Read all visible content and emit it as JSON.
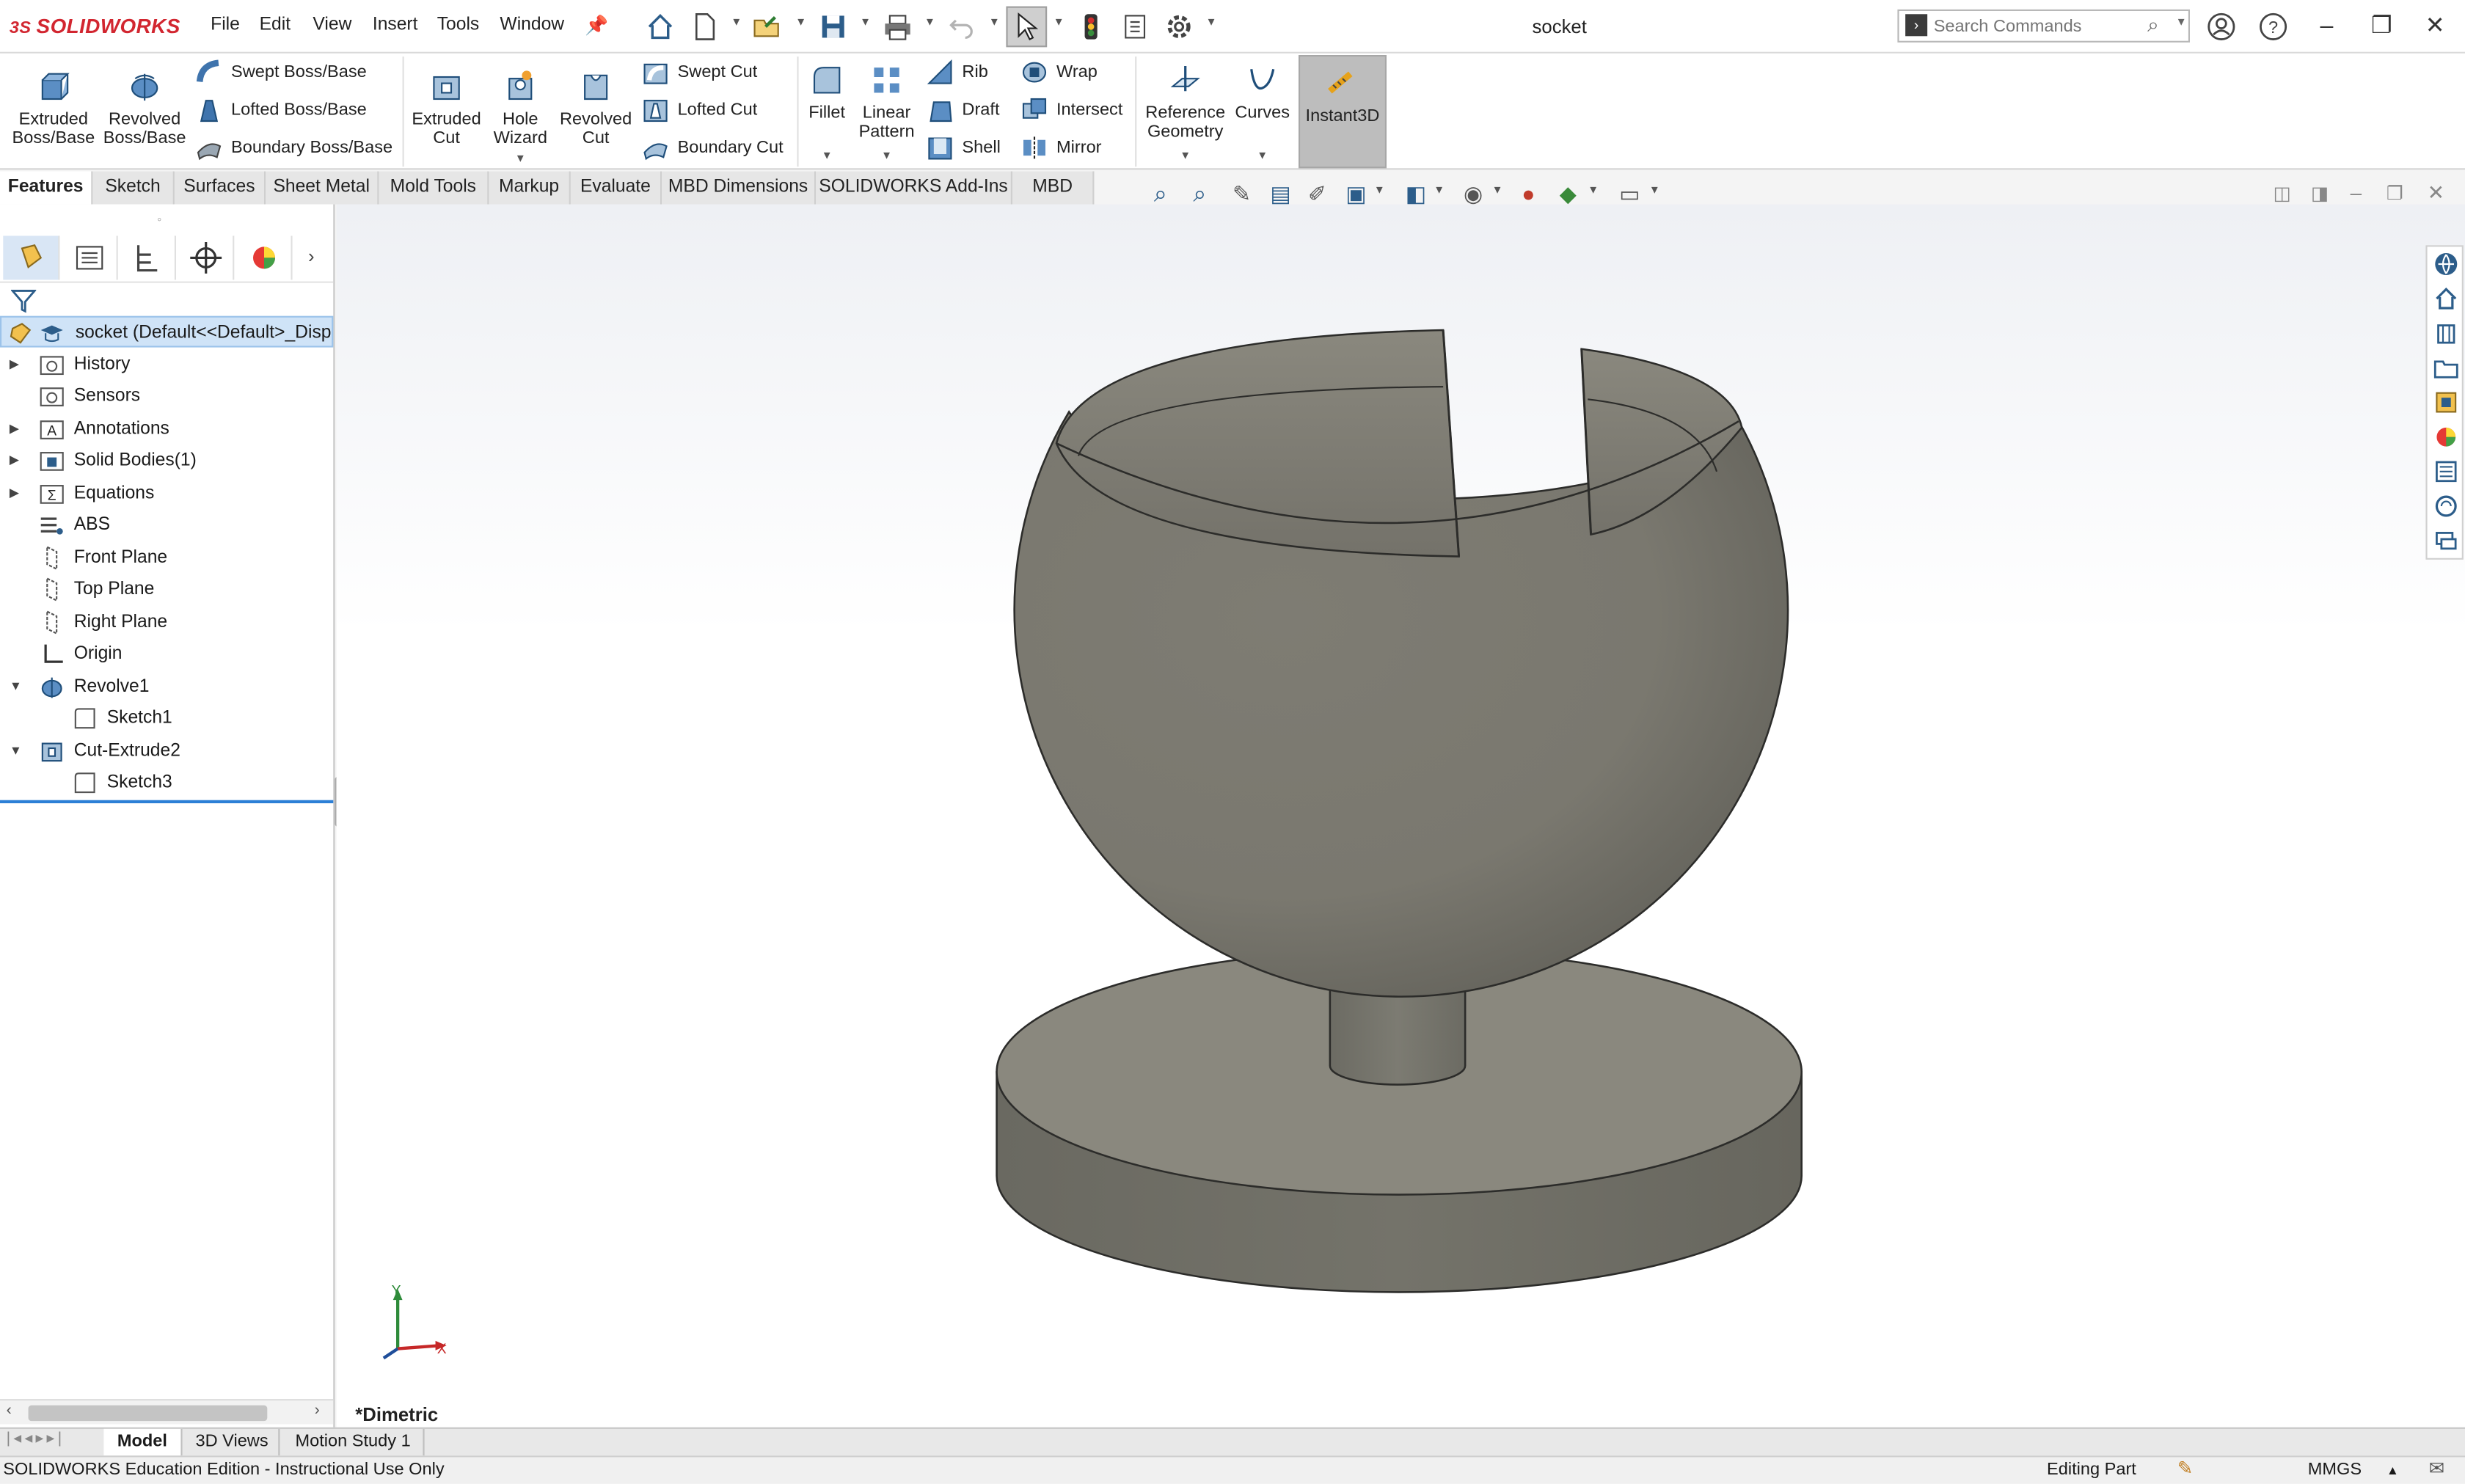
{
  "app": {
    "logo_text": "SOLIDWORKS",
    "document_title": "socket"
  },
  "menu": [
    "File",
    "Edit",
    "View",
    "Insert",
    "Tools",
    "Window"
  ],
  "search": {
    "placeholder": "Search Commands"
  },
  "ribbon": {
    "extruded_boss": [
      "Extruded",
      "Boss/Base"
    ],
    "revolved_boss": [
      "Revolved",
      "Boss/Base"
    ],
    "swept_boss": "Swept Boss/Base",
    "lofted_boss": "Lofted Boss/Base",
    "boundary_boss": "Boundary Boss/Base",
    "extruded_cut": [
      "Extruded",
      "Cut"
    ],
    "hole_wizard": [
      "Hole",
      "Wizard"
    ],
    "revolved_cut": [
      "Revolved",
      "Cut"
    ],
    "swept_cut": "Swept Cut",
    "lofted_cut": "Lofted Cut",
    "boundary_cut": "Boundary Cut",
    "fillet": "Fillet",
    "linear_pattern": [
      "Linear",
      "Pattern"
    ],
    "rib": "Rib",
    "draft": "Draft",
    "shell": "Shell",
    "wrap": "Wrap",
    "intersect": "Intersect",
    "mirror": "Mirror",
    "reference_geometry": [
      "Reference",
      "Geometry"
    ],
    "curves": "Curves",
    "instant3d": "Instant3D"
  },
  "tabs": [
    "Features",
    "Sketch",
    "Surfaces",
    "Sheet Metal",
    "Mold Tools",
    "Markup",
    "Evaluate",
    "MBD Dimensions",
    "SOLIDWORKS Add-Ins",
    "MBD"
  ],
  "tree": {
    "root": "socket  (Default<<Default>_Displ",
    "items": [
      {
        "label": "History"
      },
      {
        "label": "Sensors"
      },
      {
        "label": "Annotations"
      },
      {
        "label": "Solid Bodies(1)"
      },
      {
        "label": "Equations"
      },
      {
        "label": "ABS"
      },
      {
        "label": "Front Plane"
      },
      {
        "label": "Top Plane"
      },
      {
        "label": "Right Plane"
      },
      {
        "label": "Origin"
      },
      {
        "label": "Revolve1"
      },
      {
        "label": "Sketch1"
      },
      {
        "label": "Cut-Extrude2"
      },
      {
        "label": "Sketch3"
      }
    ]
  },
  "viewport": {
    "view_name": "*Dimetric",
    "triad": {
      "y": "Y",
      "x": "X"
    }
  },
  "bottom_tabs": [
    "Model",
    "3D Views",
    "Motion Study 1"
  ],
  "status": {
    "left": "SOLIDWORKS Education Edition - Instructional Use Only",
    "editing": "Editing Part",
    "units": "MMGS"
  },
  "colors": {
    "accent": "#d22630",
    "selection": "#cfe3f7",
    "model": "#7a7870"
  }
}
